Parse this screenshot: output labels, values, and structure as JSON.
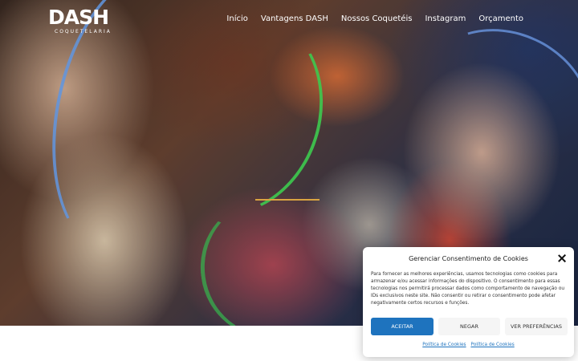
{
  "brand": {
    "name": "DASH",
    "tagline": "COQUETELARIA"
  },
  "nav": {
    "items": [
      {
        "label": "Início"
      },
      {
        "label": "Vantagens DASH"
      },
      {
        "label": "Nossos Coquetéis"
      },
      {
        "label": "Instagram"
      },
      {
        "label": "Orçamento"
      }
    ]
  },
  "hero": {
    "accent_color": "#d9a441"
  },
  "cookie_banner": {
    "title": "Gerenciar Consentimento de Cookies",
    "body": "Para fornecer as melhores experiências, usamos tecnologias como cookies para armazenar e/ou acessar informações do dispositivo. O consentimento para essas tecnologias nos permitirá processar dados como comportamento de navegação ou IDs exclusivos neste site. Não consentir ou retirar o consentimento pode afetar negativamente certos recursos e funções.",
    "accept_label": "ACEITAR",
    "deny_label": "NEGAR",
    "preferences_label": "VER PREFERÊNCIAS",
    "links": [
      {
        "label": "Política de Cookies"
      },
      {
        "label": "Política de Cookies"
      }
    ],
    "accent_color": "#1e73be"
  }
}
